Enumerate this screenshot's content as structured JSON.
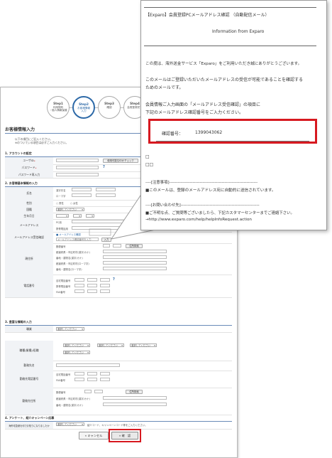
{
  "form": {
    "steps": [
      {
        "num": "Step1",
        "label": "利用規約\n・個人情報保護"
      },
      {
        "num": "Step2",
        "label": "お客様情報\n入力"
      },
      {
        "num": "Step3",
        "label": "確認"
      },
      {
        "num": "Step4",
        "label": "会員登録完了"
      }
    ],
    "title": "お客様情報入力",
    "intro1": "以下の項目にご記入ください。",
    "intro2": "※のついている項目は必ずご入力ください。",
    "sec1": "1. アカウントの設定",
    "userid_label": "ユーザID",
    "userid_check": "使用可能なIDかチェック",
    "password_label": "パスワード",
    "password_confirm_label": "パスワード再入力",
    "sec2": "2. お客様基本情報の入力",
    "name_label": "氏名",
    "name_kanji": "漢字氏名",
    "name_roman": "ローマ字",
    "gender_label": "性別",
    "gender_male": "男性",
    "gender_female": "女性",
    "country_label": "国籍",
    "country_select": "選択してください",
    "birth_label": "生年月日",
    "email_label": "メールアドレス",
    "email_pc": "PC用",
    "email_mobile": "携帯電話用",
    "email_confirm_label": "メールアドレス受信確認",
    "email_confirm_check": "メールアドレス確認",
    "email_confirm_placeholder": "メールアドレス確認番号を入力",
    "email_confirm_btn": "入力",
    "address_label": "現住所",
    "postal": "郵便番号",
    "address_search": "住所検索",
    "pref": "都道府県・市区町村(漢字/カナ)",
    "street": "番地・建物名(漢字/カナ)",
    "pref_roman": "都道府県・市区町村(ローマ字)",
    "street_roman": "番地・建物名(ローマ字)",
    "phone_label": "電話番号",
    "phone_home": "自宅電話番号",
    "phone_mobile": "携帯電話番号",
    "phone_fax": "FAX番号",
    "sec3": "3. 豊富な情報の入力",
    "job_label": "職業",
    "job_detail_label": "職種(業種)/役職",
    "work_name_label": "勤務先名",
    "work_contact_label": "勤務先電話番号",
    "work_addr_label": "勤務先住所",
    "select_placeholder": "選択してください",
    "sec4": "4. アンケート、紹介キャンペーン応募",
    "survey_label": "海外宅急便を何でお知りになりましたか",
    "survey_note": "紹介コード、キャンペーンコード等をご入力ください。",
    "cancel_btn": "キャンセル",
    "confirm_btn": "確　認"
  },
  "mail": {
    "subject": "【Exparo】会員登録PCメールアドレス確認 （自動配信メール）",
    "from": "Information from Exparo",
    "greeting": "この度は、海外送金サービス「Exparo」をご利用いただき誠にありがとうございます。",
    "body1": "このメールはご登録いただいたメールアドレスの受信が可能であることを確認する",
    "body2": "ためのメールです。",
    "body3": "会員情報ご入力画面の「メールアドレス受信確認」の項目に",
    "body4": "下記のメールアドレス確認番号をご入力ください。",
    "code_label": "確認番号：",
    "code_value": "1399043062",
    "square1": "□",
    "square2": "□□",
    "notes_header": "----[注意事項]----------------------------------------------------------------",
    "note1": "■このメールは、登録のメールアドレス宛に自動的に送信されています。",
    "inquiry_header": "----[お問い合わせ先]---------------------------------------------------------",
    "inquiry1": "■ご不明な点、ご質問等ございましたら、下記カスタマーセンターまでご連絡下さい。",
    "inquiry_url": "→http://www.exparo.com/help/helpInfoRequest.action"
  },
  "colors": {
    "highlight": "#d71920",
    "accent": "#2e6aa8"
  }
}
